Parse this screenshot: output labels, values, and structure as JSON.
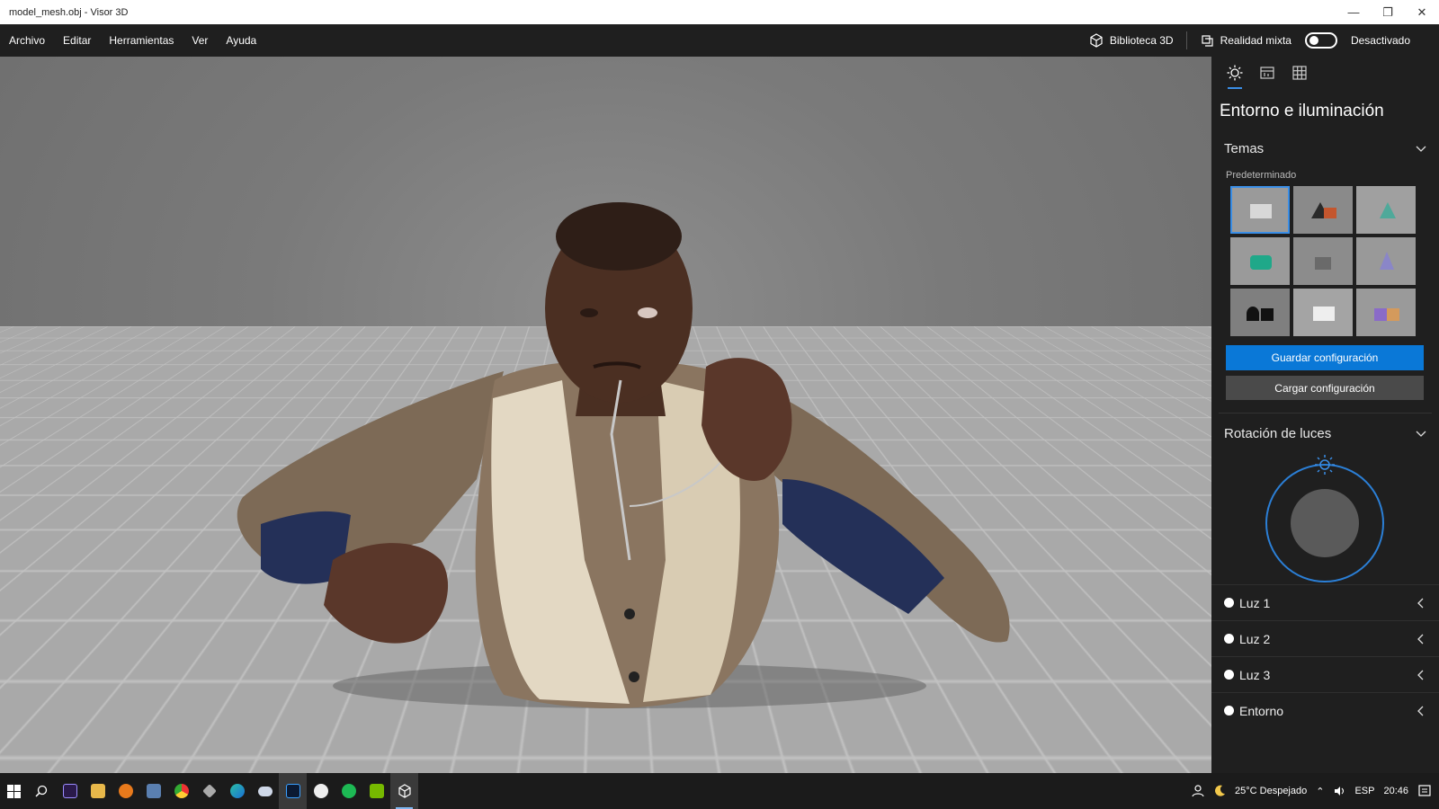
{
  "window": {
    "title": "model_mesh.obj - Visor 3D",
    "controls": [
      "minimize-icon",
      "restore-icon",
      "close-icon"
    ]
  },
  "menu": {
    "items": [
      "Archivo",
      "Editar",
      "Herramientas",
      "Ver",
      "Ayuda"
    ],
    "library_label": "Biblioteca 3D",
    "mixed_reality_label": "Realidad mixta",
    "mixed_reality_state": "Desactivado",
    "mixed_reality_on": false
  },
  "panel": {
    "tabs": [
      "sun-icon",
      "stats-icon",
      "grid-icon"
    ],
    "active_tab": 0,
    "title": "Entorno e iluminación",
    "themes": {
      "heading": "Temas",
      "sublabel": "Predeterminado",
      "selected_index": 0
    },
    "save_label": "Guardar configuración",
    "load_label": "Cargar configuración",
    "rotation_heading": "Rotación de luces",
    "lights": [
      {
        "label": "Luz 1"
      },
      {
        "label": "Luz 2"
      },
      {
        "label": "Luz 3"
      },
      {
        "label": "Entorno"
      }
    ]
  },
  "taskbar": {
    "weather": "25°C  Despejado",
    "language": "ESP",
    "time": "20:46"
  },
  "colors": {
    "accent": "#0a78d7",
    "panel_bg": "#1f1f1f",
    "viewport_bg": "#7a7a7a"
  }
}
